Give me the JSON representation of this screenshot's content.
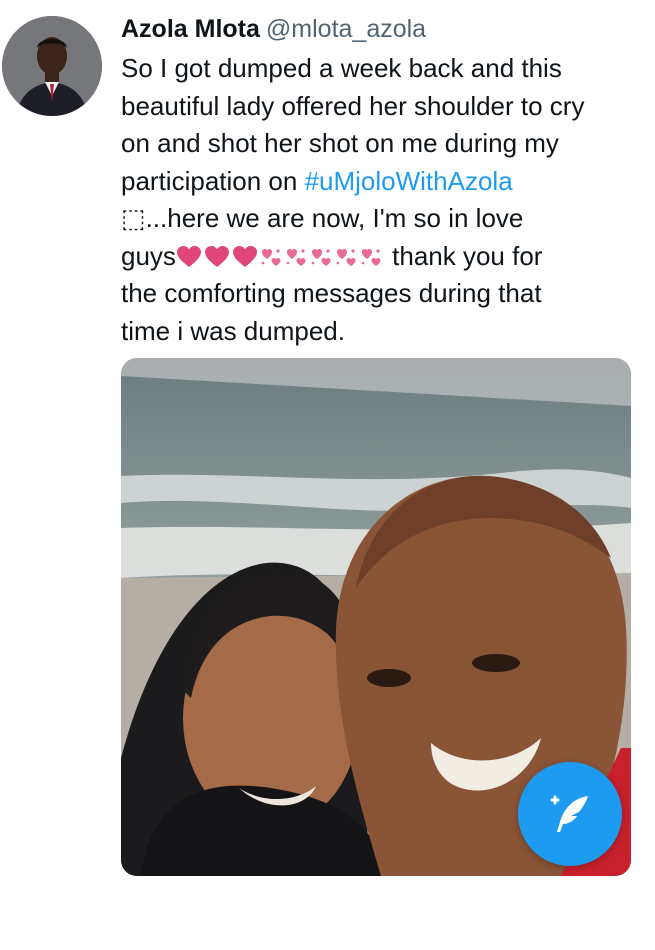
{
  "tweet": {
    "author_name": "Azola Mlota",
    "author_handle": "@mlota_azola",
    "text": {
      "line1": "So I got dumped a week back and this",
      "line2": "beautiful lady offered her shoulder to cry",
      "line3": "on and shot her shot on me during my",
      "line4_prefix": "participation on ",
      "hashtag": "#uMjoloWithAzola",
      "line5": "⬚...here we are now, I'm so in love",
      "line6_prefix": "guys",
      "line6_suffix": " thank you for",
      "line7": "the comforting messages during that",
      "line8": "time i was dumped."
    },
    "emojis": [
      "heart",
      "heart",
      "heart",
      "sparkling-heart",
      "sparkling-heart",
      "sparkling-heart",
      "sparkling-heart",
      "sparkling-heart"
    ]
  },
  "media": {
    "alt": "photo"
  },
  "compose_button": {
    "icon": "compose-feather-icon"
  },
  "colors": {
    "link": "#1d9bf0",
    "text": "#0f1419",
    "secondary": "#536471",
    "heart": "#e0457b",
    "fab": "#1d9bf0"
  }
}
